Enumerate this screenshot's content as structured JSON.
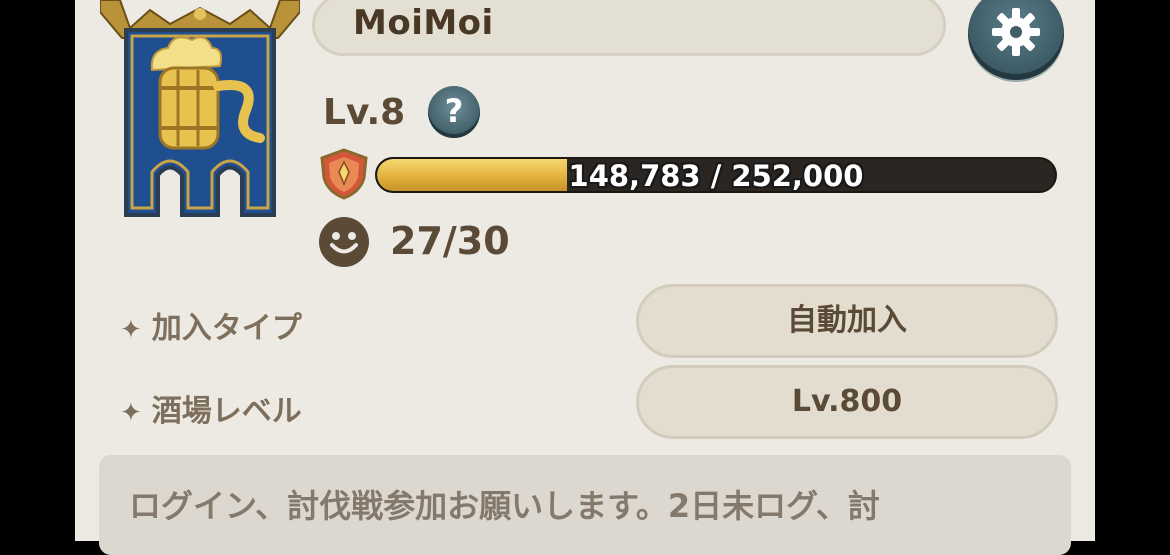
{
  "guild": {
    "name": "MoiMoi",
    "level_label": "Lv.8",
    "help_symbol": "?",
    "xp": {
      "text": "148,783 / 252,000",
      "current": 148783,
      "max": 252000,
      "fill_fraction": 0.28
    },
    "members": "27/30"
  },
  "settings": [
    {
      "label": "加入タイプ",
      "value": "自動加入"
    },
    {
      "label": "酒場レベル",
      "value": "Lv.800"
    }
  ],
  "star_glyph": "✦",
  "message": "ログイン、討伐戦参加お願いします。2日未ログ、討",
  "icons": {
    "banner": "guild-beer-barrel-banner-icon",
    "settings": "gear-icon",
    "help": "question-icon",
    "xp": "shield-crest-icon",
    "members": "smile-icon"
  },
  "colors": {
    "panel": "#eceae3",
    "banner_blue": "#1f4f8f",
    "gold": "#e2b23c",
    "text_brown": "#5a4a36",
    "button_teal": "#3f5e68"
  }
}
